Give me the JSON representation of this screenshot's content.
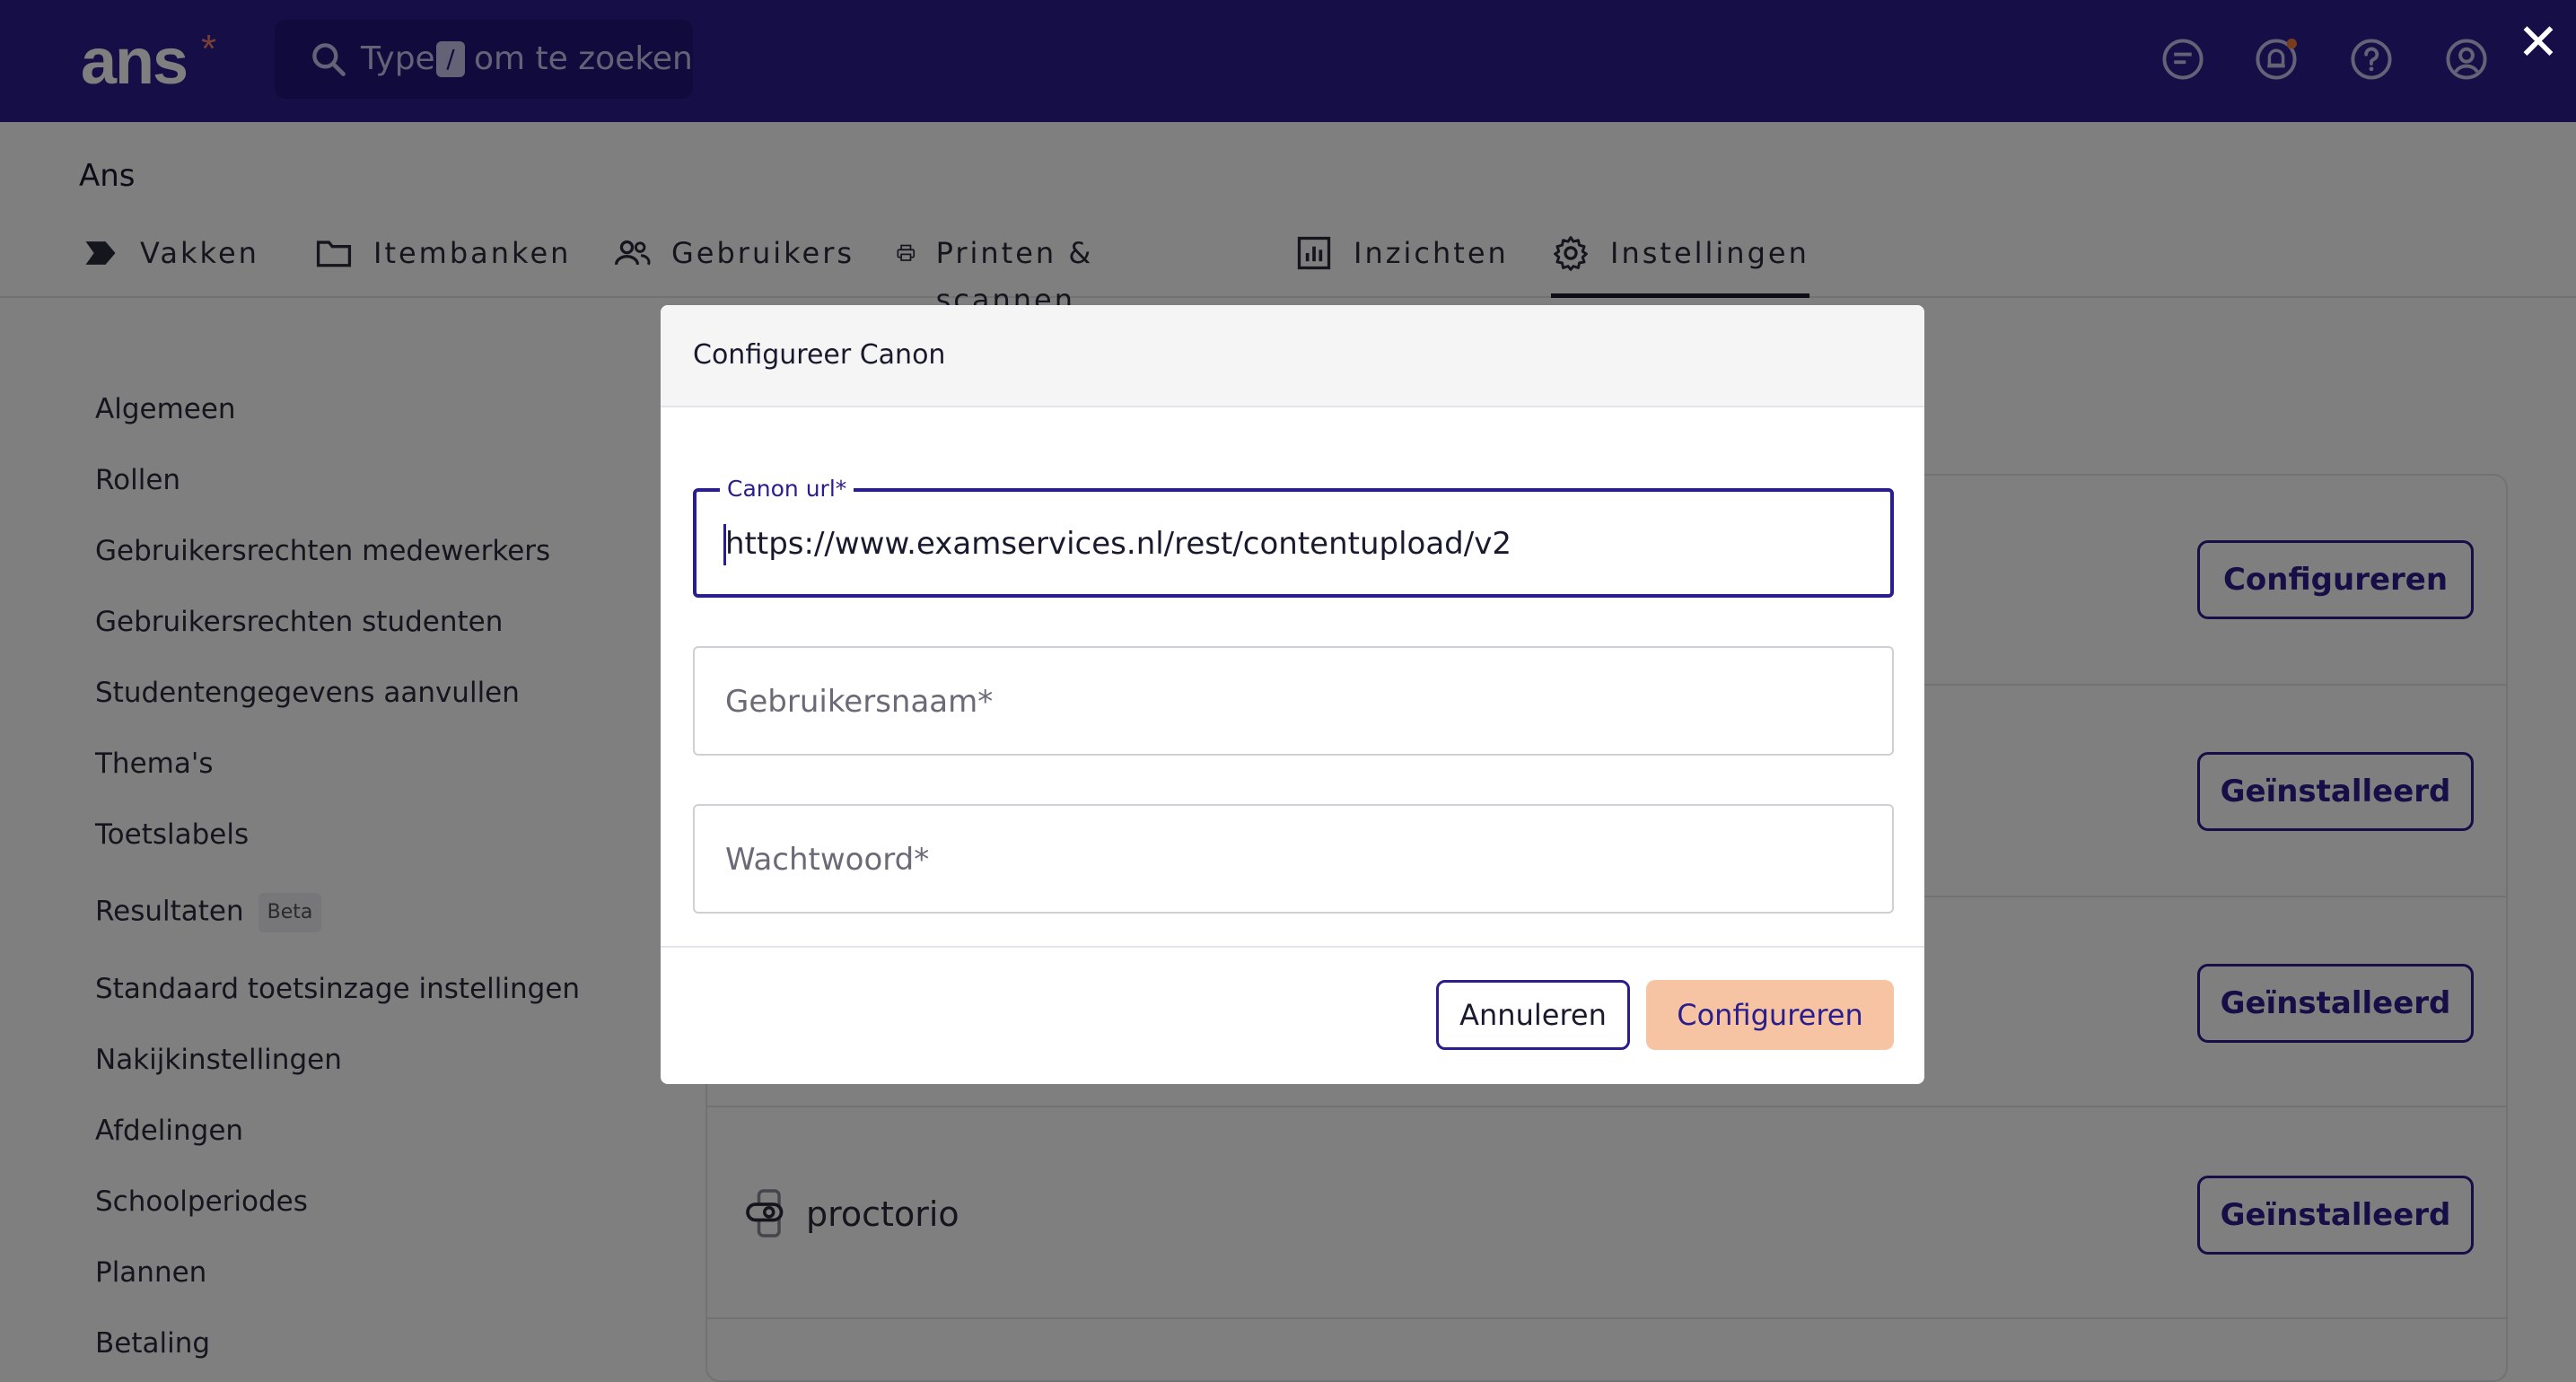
{
  "topbar": {
    "logo": "ans",
    "logo_mark": "*",
    "search": {
      "prefix": "Type",
      "key": "/",
      "suffix": "om te zoeken"
    },
    "icons": [
      "chat-icon",
      "bell-icon",
      "help-icon",
      "account-icon"
    ],
    "close": "✕"
  },
  "header": {
    "app_name": "Ans",
    "nav": [
      {
        "label": "Vakken",
        "icon": "chevron-tag-icon"
      },
      {
        "label": "Itembanken",
        "icon": "folder-icon"
      },
      {
        "label": "Gebruikers",
        "icon": "users-icon"
      },
      {
        "label": "Printen & scannen",
        "icon": "printer-icon"
      },
      {
        "label": "Inzichten",
        "icon": "bar-chart-icon"
      },
      {
        "label": "Instellingen",
        "icon": "gear-icon",
        "active": true
      }
    ]
  },
  "sidebar": {
    "items": [
      {
        "label": "Algemeen"
      },
      {
        "label": "Rollen"
      },
      {
        "label": "Gebruikersrechten medewerkers"
      },
      {
        "label": "Gebruikersrechten studenten"
      },
      {
        "label": "Studentengegevens aanvullen"
      },
      {
        "label": "Thema's"
      },
      {
        "label": "Toetslabels"
      },
      {
        "label": "Resultaten",
        "badge": "Beta"
      },
      {
        "label": "Standaard toetsinzage instellingen"
      },
      {
        "label": "Nakijkinstellingen"
      },
      {
        "label": "Afdelingen"
      },
      {
        "label": "Schoolperiodes"
      },
      {
        "label": "Plannen"
      },
      {
        "label": "Betaling"
      }
    ]
  },
  "content": {
    "rows": [
      {
        "button": "Configureren"
      },
      {
        "button": "Geïnstalleerd"
      },
      {
        "button": "Geïnstalleerd"
      },
      {
        "name": "proctorio",
        "button": "Geïnstalleerd"
      }
    ]
  },
  "modal": {
    "title": "Configureer Canon",
    "fields": [
      {
        "label": "Canon url*",
        "value": "https://www.examservices.nl/rest/contentupload/v2"
      },
      {
        "placeholder": "Gebruikersnaam*"
      },
      {
        "placeholder": "Wachtwoord*"
      }
    ],
    "cancel_label": "Annuleren",
    "confirm_label": "Configureren"
  },
  "colors": {
    "primary": "#2a1d8e",
    "accent": "#f6c4a3",
    "notification_dot": "#f07a3a"
  }
}
